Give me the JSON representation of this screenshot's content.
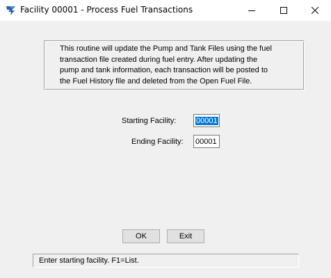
{
  "window": {
    "title": "Facility 00001 - Process Fuel Transactions",
    "icon": "app-logo-icon",
    "controls": [
      "minimize-icon",
      "maximize-icon",
      "close-icon"
    ]
  },
  "info": {
    "lines": [
      "This routine will update the Pump and Tank Files using the fuel",
      "transaction file created during fuel entry.  After updating the",
      "pump and tank information, each transaction will be posted to",
      "the Fuel History file and deleted from the Open Fuel File."
    ]
  },
  "form": {
    "starting_facility_label": "Starting Facility:",
    "starting_facility_value": "00001",
    "ending_facility_label": "Ending Facility:",
    "ending_facility_value": "00001"
  },
  "buttons": {
    "ok_label": "OK",
    "exit_label": "Exit"
  },
  "status": {
    "text": "Enter starting facility. F1=List."
  },
  "colors": {
    "selection": "#0078d7",
    "background": "#f0f0f0",
    "title_bar": "#ffffff"
  }
}
